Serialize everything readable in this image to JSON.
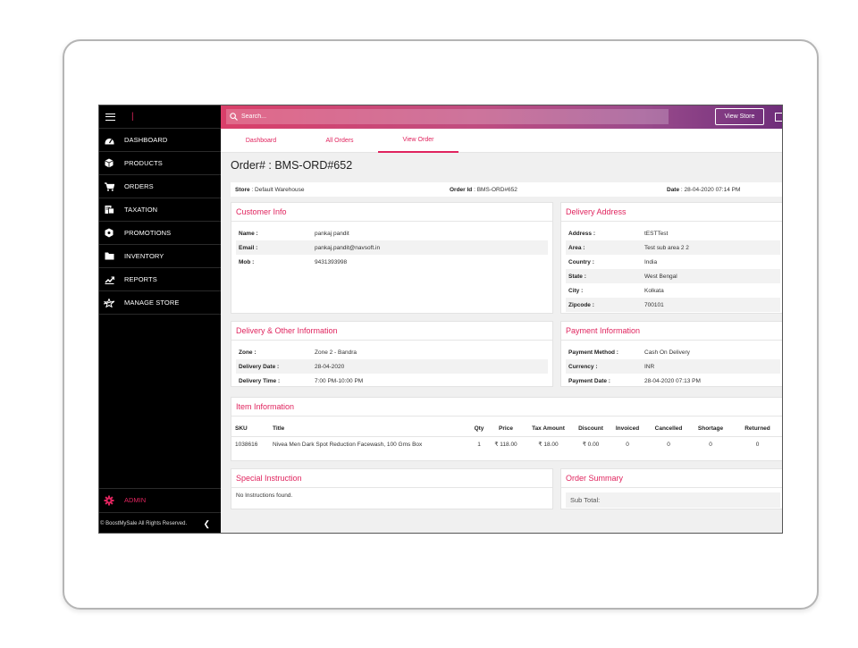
{
  "sidebar": {
    "items": [
      {
        "label": "DASHBOARD",
        "icon": "dashboard-icon"
      },
      {
        "label": "PRODUCTS",
        "icon": "box-icon"
      },
      {
        "label": "ORDERS",
        "icon": "cart-icon"
      },
      {
        "label": "TAXATION",
        "icon": "tax-icon"
      },
      {
        "label": "PROMOTIONS",
        "icon": "promotions-icon"
      },
      {
        "label": "INVENTORY",
        "icon": "folder-icon"
      },
      {
        "label": "REPORTS",
        "icon": "reports-icon"
      },
      {
        "label": "MANAGE STORE",
        "icon": "store-icon"
      }
    ],
    "admin_label": "ADMIN",
    "footer": "© BoostMySale All Rights Reserved."
  },
  "topbar": {
    "search_placeholder": "Search...",
    "view_store": "View Store"
  },
  "tabs": [
    "Dashboard",
    "All Orders",
    "View Order"
  ],
  "order": {
    "title": "Order# : BMS-ORD#652",
    "store_label": "Store",
    "store_value": " : Default Warehouse",
    "order_id_label": "Order Id",
    "order_id_value": " : BMS-ORD#652",
    "date_label": "Date",
    "date_value": " : 28-04-2020 07:14 PM"
  },
  "customer": {
    "heading": "Customer Info",
    "rows": [
      {
        "k": "Name :",
        "v": "pankaj pandit"
      },
      {
        "k": "Email :",
        "v": "pankaj.pandit@navsoft.in"
      },
      {
        "k": "Mob :",
        "v": "9431393998"
      }
    ]
  },
  "delivery_address": {
    "heading": "Delivery Address",
    "rows": [
      {
        "k": "Address :",
        "v": "tESTTest"
      },
      {
        "k": "Area :",
        "v": "Test sub area 2 2"
      },
      {
        "k": "Country :",
        "v": "India"
      },
      {
        "k": "State :",
        "v": "West Bengal"
      },
      {
        "k": "City :",
        "v": "Kolkata"
      },
      {
        "k": "Zipcode :",
        "v": "700101"
      }
    ]
  },
  "delivery_other": {
    "heading": "Delivery & Other Information",
    "rows": [
      {
        "k": "Zone :",
        "v": "Zone 2 - Bandra"
      },
      {
        "k": "Delivery Date :",
        "v": "28-04-2020"
      },
      {
        "k": "Delivery Time :",
        "v": "7:00 PM-10:00 PM"
      }
    ]
  },
  "payment": {
    "heading": "Payment Information",
    "rows": [
      {
        "k": "Payment Method :",
        "v": "Cash On Delivery"
      },
      {
        "k": "Currency :",
        "v": "INR"
      },
      {
        "k": "Payment Date :",
        "v": "28-04-2020 07:13 PM"
      }
    ]
  },
  "items": {
    "heading": "Item Information",
    "columns": [
      "SKU",
      "Title",
      "Qty",
      "Price",
      "Tax Amount",
      "Discount",
      "Invoiced",
      "Cancelled",
      "Shortage",
      "Returned"
    ],
    "rows": [
      [
        "1038616",
        "Nivea Men Dark Spot Reduction Facewash, 100 Gms Box",
        "1",
        "₹ 118.00",
        "₹ 18.00",
        "₹ 0.00",
        "0",
        "0",
        "0",
        "0"
      ]
    ]
  },
  "special": {
    "heading": "Special Instruction",
    "text": "No Instructions found."
  },
  "summary": {
    "heading": "Order Summary",
    "sub_total": "Sub Total:"
  }
}
